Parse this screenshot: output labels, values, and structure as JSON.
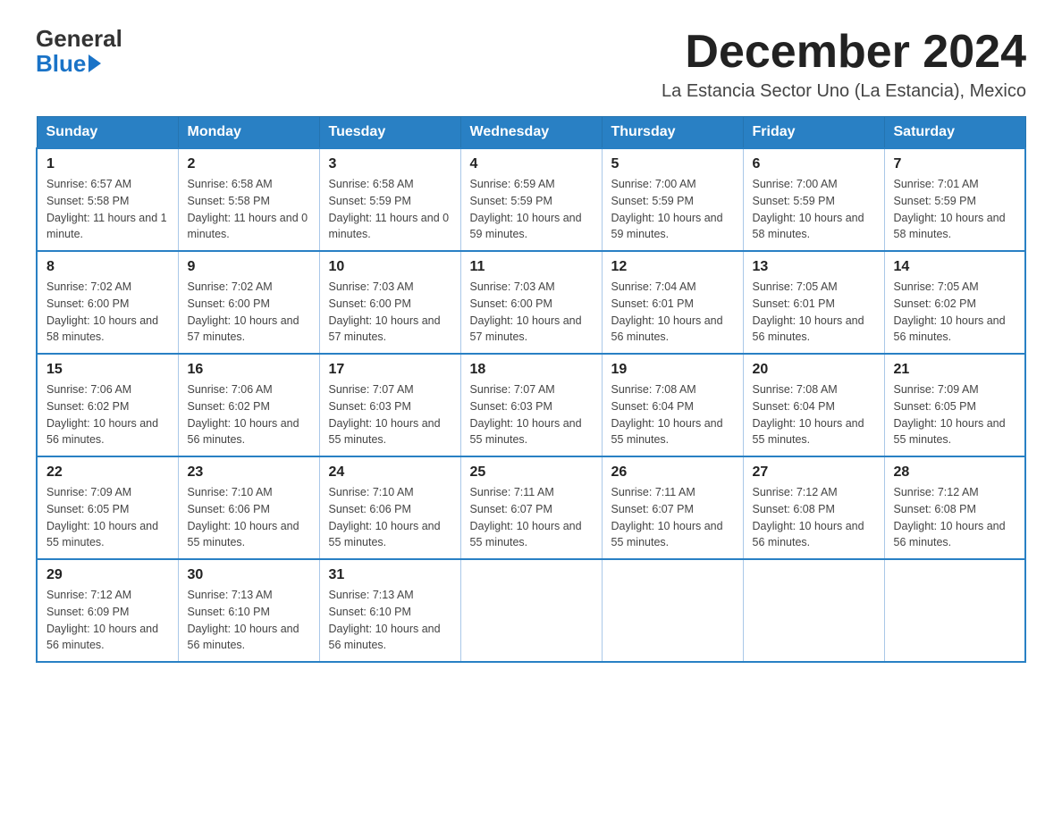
{
  "logo": {
    "general": "General",
    "blue": "Blue"
  },
  "header": {
    "month_title": "December 2024",
    "subtitle": "La Estancia Sector Uno (La Estancia), Mexico"
  },
  "days_of_week": [
    "Sunday",
    "Monday",
    "Tuesday",
    "Wednesday",
    "Thursday",
    "Friday",
    "Saturday"
  ],
  "weeks": [
    [
      {
        "day": "1",
        "sunrise": "6:57 AM",
        "sunset": "5:58 PM",
        "daylight": "11 hours and 1 minute."
      },
      {
        "day": "2",
        "sunrise": "6:58 AM",
        "sunset": "5:58 PM",
        "daylight": "11 hours and 0 minutes."
      },
      {
        "day": "3",
        "sunrise": "6:58 AM",
        "sunset": "5:59 PM",
        "daylight": "11 hours and 0 minutes."
      },
      {
        "day": "4",
        "sunrise": "6:59 AM",
        "sunset": "5:59 PM",
        "daylight": "10 hours and 59 minutes."
      },
      {
        "day": "5",
        "sunrise": "7:00 AM",
        "sunset": "5:59 PM",
        "daylight": "10 hours and 59 minutes."
      },
      {
        "day": "6",
        "sunrise": "7:00 AM",
        "sunset": "5:59 PM",
        "daylight": "10 hours and 58 minutes."
      },
      {
        "day": "7",
        "sunrise": "7:01 AM",
        "sunset": "5:59 PM",
        "daylight": "10 hours and 58 minutes."
      }
    ],
    [
      {
        "day": "8",
        "sunrise": "7:02 AM",
        "sunset": "6:00 PM",
        "daylight": "10 hours and 58 minutes."
      },
      {
        "day": "9",
        "sunrise": "7:02 AM",
        "sunset": "6:00 PM",
        "daylight": "10 hours and 57 minutes."
      },
      {
        "day": "10",
        "sunrise": "7:03 AM",
        "sunset": "6:00 PM",
        "daylight": "10 hours and 57 minutes."
      },
      {
        "day": "11",
        "sunrise": "7:03 AM",
        "sunset": "6:00 PM",
        "daylight": "10 hours and 57 minutes."
      },
      {
        "day": "12",
        "sunrise": "7:04 AM",
        "sunset": "6:01 PM",
        "daylight": "10 hours and 56 minutes."
      },
      {
        "day": "13",
        "sunrise": "7:05 AM",
        "sunset": "6:01 PM",
        "daylight": "10 hours and 56 minutes."
      },
      {
        "day": "14",
        "sunrise": "7:05 AM",
        "sunset": "6:02 PM",
        "daylight": "10 hours and 56 minutes."
      }
    ],
    [
      {
        "day": "15",
        "sunrise": "7:06 AM",
        "sunset": "6:02 PM",
        "daylight": "10 hours and 56 minutes."
      },
      {
        "day": "16",
        "sunrise": "7:06 AM",
        "sunset": "6:02 PM",
        "daylight": "10 hours and 56 minutes."
      },
      {
        "day": "17",
        "sunrise": "7:07 AM",
        "sunset": "6:03 PM",
        "daylight": "10 hours and 55 minutes."
      },
      {
        "day": "18",
        "sunrise": "7:07 AM",
        "sunset": "6:03 PM",
        "daylight": "10 hours and 55 minutes."
      },
      {
        "day": "19",
        "sunrise": "7:08 AM",
        "sunset": "6:04 PM",
        "daylight": "10 hours and 55 minutes."
      },
      {
        "day": "20",
        "sunrise": "7:08 AM",
        "sunset": "6:04 PM",
        "daylight": "10 hours and 55 minutes."
      },
      {
        "day": "21",
        "sunrise": "7:09 AM",
        "sunset": "6:05 PM",
        "daylight": "10 hours and 55 minutes."
      }
    ],
    [
      {
        "day": "22",
        "sunrise": "7:09 AM",
        "sunset": "6:05 PM",
        "daylight": "10 hours and 55 minutes."
      },
      {
        "day": "23",
        "sunrise": "7:10 AM",
        "sunset": "6:06 PM",
        "daylight": "10 hours and 55 minutes."
      },
      {
        "day": "24",
        "sunrise": "7:10 AM",
        "sunset": "6:06 PM",
        "daylight": "10 hours and 55 minutes."
      },
      {
        "day": "25",
        "sunrise": "7:11 AM",
        "sunset": "6:07 PM",
        "daylight": "10 hours and 55 minutes."
      },
      {
        "day": "26",
        "sunrise": "7:11 AM",
        "sunset": "6:07 PM",
        "daylight": "10 hours and 55 minutes."
      },
      {
        "day": "27",
        "sunrise": "7:12 AM",
        "sunset": "6:08 PM",
        "daylight": "10 hours and 56 minutes."
      },
      {
        "day": "28",
        "sunrise": "7:12 AM",
        "sunset": "6:08 PM",
        "daylight": "10 hours and 56 minutes."
      }
    ],
    [
      {
        "day": "29",
        "sunrise": "7:12 AM",
        "sunset": "6:09 PM",
        "daylight": "10 hours and 56 minutes."
      },
      {
        "day": "30",
        "sunrise": "7:13 AM",
        "sunset": "6:10 PM",
        "daylight": "10 hours and 56 minutes."
      },
      {
        "day": "31",
        "sunrise": "7:13 AM",
        "sunset": "6:10 PM",
        "daylight": "10 hours and 56 minutes."
      },
      null,
      null,
      null,
      null
    ]
  ]
}
